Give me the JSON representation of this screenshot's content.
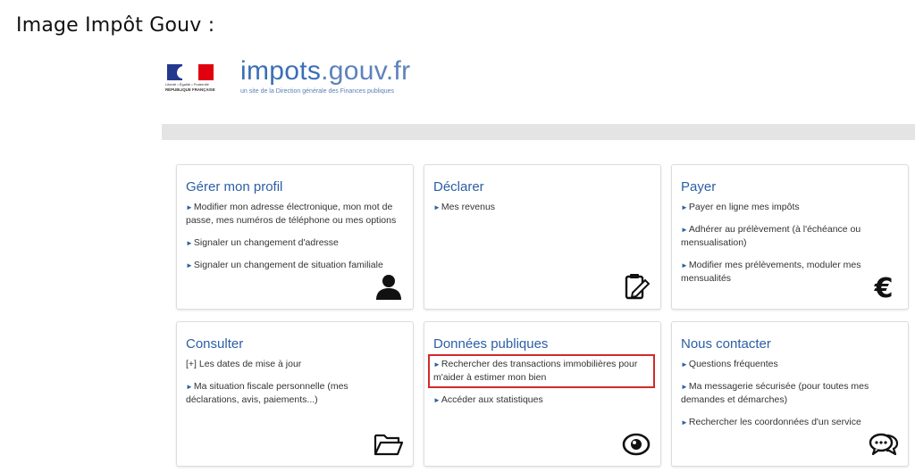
{
  "caption": "Image Impôt Gouv :",
  "header": {
    "motto_1": "Liberté • Égalité • Fraternité",
    "republic": "RÉPUBLIQUE FRANÇAISE",
    "logo_main": "impots",
    "logo_ext": ".gouv.fr",
    "tagline": "un site de la Direction générale des Finances publiques"
  },
  "cards": [
    {
      "title": "Gérer mon profil",
      "icon": "user-icon",
      "links": [
        "Modifier mon adresse électronique, mon mot de passe, mes numéros de téléphone ou mes options",
        "Signaler un changement d'adresse",
        "Signaler un changement de situation familiale"
      ]
    },
    {
      "title": "Déclarer",
      "icon": "clipboard-edit-icon",
      "links": [
        "Mes revenus"
      ]
    },
    {
      "title": "Payer",
      "icon": "euro-icon",
      "links": [
        "Payer en ligne mes impôts",
        "Adhérer au prélèvement (à l'échéance ou mensualisation)",
        "Modifier mes prélèvements, moduler mes mensualités"
      ]
    },
    {
      "title": "Consulter",
      "icon": "folder-open-icon",
      "links": [
        "[+] Les dates de mise à jour",
        "Ma situation fiscale personnelle (mes déclarations, avis, paiements...)"
      ]
    },
    {
      "title": "Données publiques",
      "icon": "eye-icon",
      "links": [
        "Rechercher des transactions immobilières pour m'aider à estimer mon bien",
        "Accéder aux statistiques"
      ]
    },
    {
      "title": "Nous contacter",
      "icon": "chat-bubbles-icon",
      "links": [
        "Questions fréquentes",
        "Ma messagerie sécurisée (pour toutes mes demandes et démarches)",
        "Rechercher les coordonnées d'un service"
      ]
    }
  ],
  "colors": {
    "title_blue": "#2b5fa4",
    "logo_blue": "#3b6fb6",
    "highlight_red": "#d12a2a",
    "gray_bar": "#e4e4e4"
  }
}
